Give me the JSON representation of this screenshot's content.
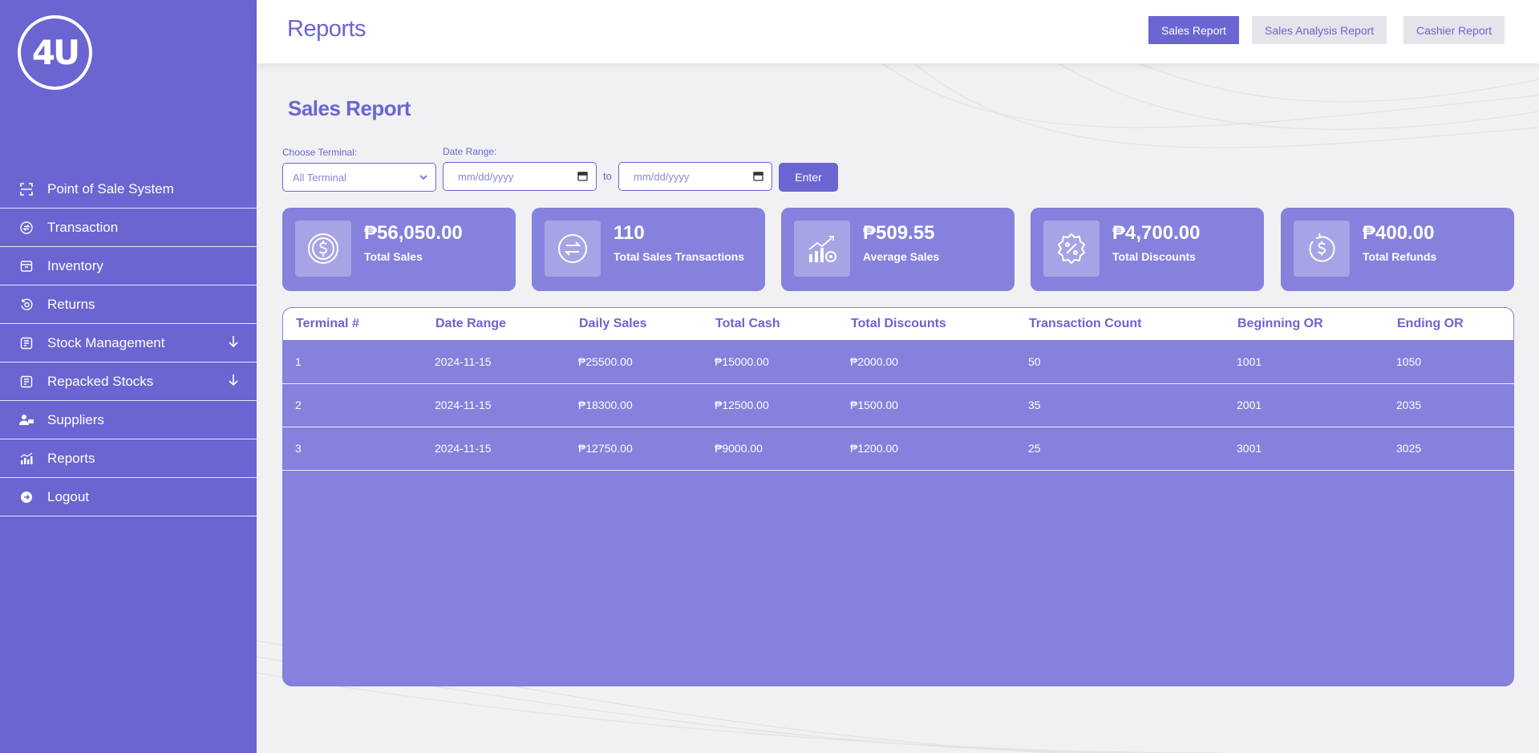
{
  "logo": {
    "text": "4U"
  },
  "sidebar": {
    "items": [
      {
        "label": "Point of Sale System",
        "icon": "scan-icon"
      },
      {
        "label": "Transaction",
        "icon": "exchange-icon"
      },
      {
        "label": "Inventory",
        "icon": "box-icon"
      },
      {
        "label": "Returns",
        "icon": "return-icon"
      },
      {
        "label": "Stock Management",
        "icon": "stock-icon",
        "expandable": true
      },
      {
        "label": "Repacked Stocks",
        "icon": "repack-icon",
        "expandable": true
      },
      {
        "label": "Suppliers",
        "icon": "suppliers-icon"
      },
      {
        "label": "Reports",
        "icon": "chart-icon"
      },
      {
        "label": "Logout",
        "icon": "logout-icon"
      }
    ]
  },
  "header": {
    "title": "Reports",
    "buttons": [
      {
        "label": "Sales Report",
        "active": true
      },
      {
        "label": "Sales Analysis Report",
        "active": false
      },
      {
        "label": "Cashier Report",
        "active": false
      }
    ]
  },
  "main": {
    "section_title": "Sales Report",
    "filters": {
      "terminal_label": "Choose Terminal:",
      "terminal_value": "All Terminal",
      "date_label": "Date Range:",
      "date_from_placeholder": "mm/dd/yyyy",
      "date_to_placeholder": "mm/dd/yyyy",
      "to_text": "to",
      "enter_label": "Enter"
    },
    "cards": [
      {
        "value": "₱56,050.00",
        "caption": "Total Sales",
        "icon": "dollar-coin-icon"
      },
      {
        "value": "110",
        "caption": "Total Sales Transactions",
        "icon": "transfer-icon"
      },
      {
        "value": "₱509.55",
        "caption": "Average Sales",
        "icon": "growth-chart-icon"
      },
      {
        "value": "₱4,700.00",
        "caption": "Total Discounts",
        "icon": "discount-badge-icon"
      },
      {
        "value": "₱400.00",
        "caption": "Total Refunds",
        "icon": "refund-icon"
      }
    ],
    "table": {
      "headers": [
        "Terminal #",
        "Date Range",
        "Daily Sales",
        "Total Cash",
        "Total Discounts",
        "Transaction Count",
        "Beginning OR",
        "Ending OR"
      ],
      "rows": [
        [
          "1",
          "2024-11-15",
          "₱25500.00",
          "₱15000.00",
          "₱2000.00",
          "50",
          "1001",
          "1050"
        ],
        [
          "2",
          "2024-11-15",
          "₱18300.00",
          "₱12500.00",
          "₱1500.00",
          "35",
          "2001",
          "2035"
        ],
        [
          "3",
          "2024-11-15",
          "₱12750.00",
          "₱9000.00",
          "₱1200.00",
          "25",
          "3001",
          "3025"
        ]
      ]
    }
  },
  "colors": {
    "primary": "#6a65d1",
    "card": "#8581dc",
    "inactive_button": "#e4e4ea"
  }
}
